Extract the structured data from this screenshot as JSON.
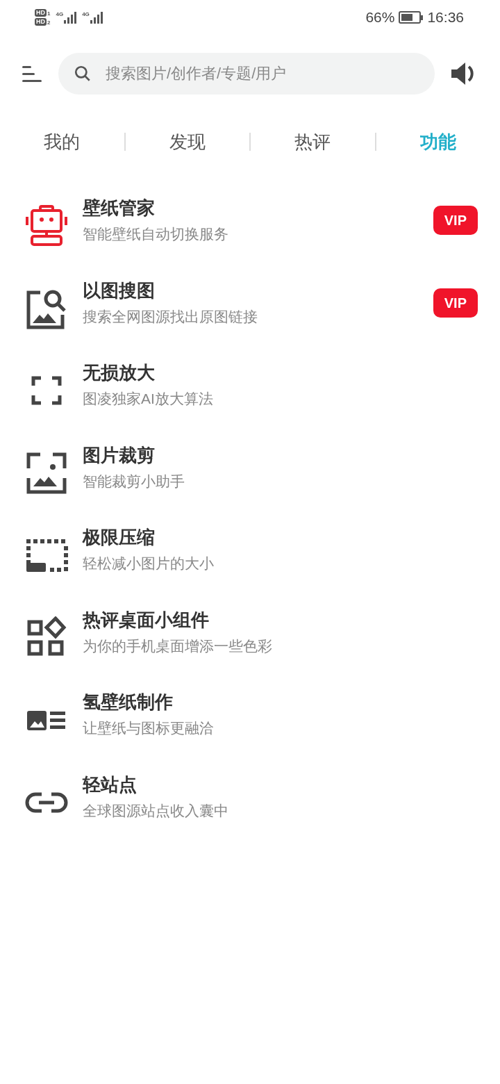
{
  "status_bar": {
    "sims": [
      {
        "badge": "HD",
        "slot": "1",
        "network": "4G"
      },
      {
        "badge": "HD",
        "slot": "2",
        "network": "4G"
      }
    ],
    "battery_text": "66%",
    "time": "16:36"
  },
  "search": {
    "placeholder": "搜索图片/创作者/专题/用户"
  },
  "tabs": [
    {
      "label": "我的",
      "selected": false
    },
    {
      "label": "发现",
      "selected": false
    },
    {
      "label": "热评",
      "selected": false
    },
    {
      "label": "功能",
      "selected": true
    }
  ],
  "features": [
    {
      "kind": "robot",
      "title": "壁纸管家",
      "subtitle": "智能壁纸自动切换服务",
      "badge": "VIP"
    },
    {
      "kind": "image-search",
      "title": "以图搜图",
      "subtitle": "搜索全网图源找出原图链接",
      "badge": "VIP"
    },
    {
      "kind": "expand",
      "title": "无损放大",
      "subtitle": "图凌独家AI放大算法"
    },
    {
      "kind": "crop",
      "title": "图片裁剪",
      "subtitle": "智能裁剪小助手"
    },
    {
      "kind": "compress",
      "title": "极限压缩",
      "subtitle": "轻松减小图片的大小"
    },
    {
      "kind": "widgets",
      "title": "热评桌面小组件",
      "subtitle": "为你的手机桌面增添一些色彩"
    },
    {
      "kind": "image-list",
      "title": "氢壁纸制作",
      "subtitle": "让壁纸与图标更融洽"
    },
    {
      "kind": "link",
      "title": "轻站点",
      "subtitle": "全球图源站点收入囊中"
    }
  ]
}
